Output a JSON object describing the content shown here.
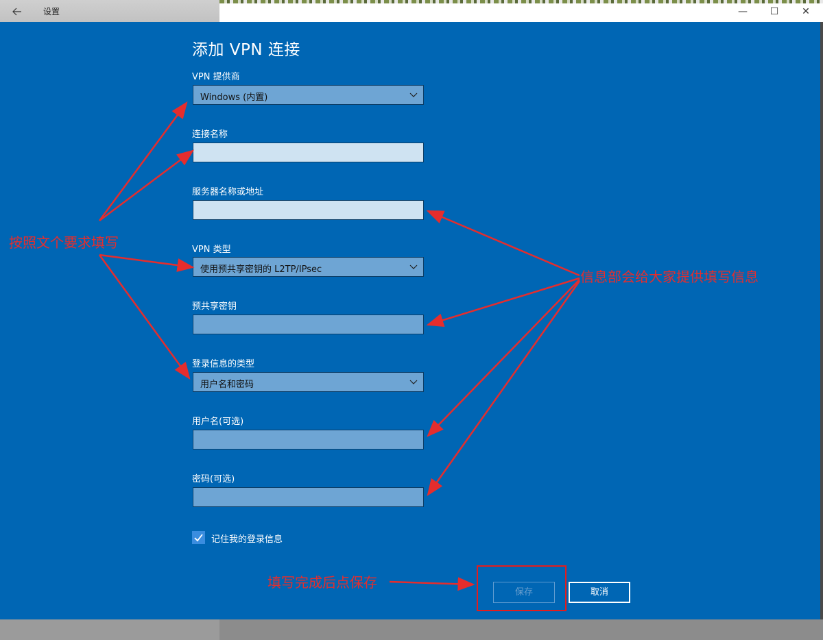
{
  "window": {
    "app_title": "设置",
    "back_icon": "arrow-left-icon",
    "controls": {
      "minimize": "—",
      "maximize": "☐",
      "close": "✕"
    }
  },
  "page": {
    "title": "添加 VPN 连接"
  },
  "form": {
    "provider_label": "VPN 提供商",
    "provider_value": "Windows (内置)",
    "connection_name_label": "连接名称",
    "connection_name_value": "",
    "server_label": "服务器名称或地址",
    "server_value": "",
    "vpn_type_label": "VPN 类型",
    "vpn_type_value": "使用预共享密钥的 L2TP/IPsec",
    "psk_label": "预共享密钥",
    "psk_value": "",
    "signin_type_label": "登录信息的类型",
    "signin_type_value": "用户名和密码",
    "username_label": "用户名(可选)",
    "username_value": "",
    "password_label": "密码(可选)",
    "password_value": "",
    "remember_label": "记住我的登录信息",
    "remember_checked": true
  },
  "buttons": {
    "save": "保存",
    "cancel": "取消"
  },
  "annotations": {
    "left_note": "按照文个要求填写",
    "right_note": "信息部会给大家提供填写信息",
    "bottom_note": "填写完成后点保存",
    "color": "#e52d2d"
  },
  "colors": {
    "accent_blue": "#0066b4",
    "field_light": "#cfe3f2",
    "field_mid": "#6ea5d4"
  }
}
